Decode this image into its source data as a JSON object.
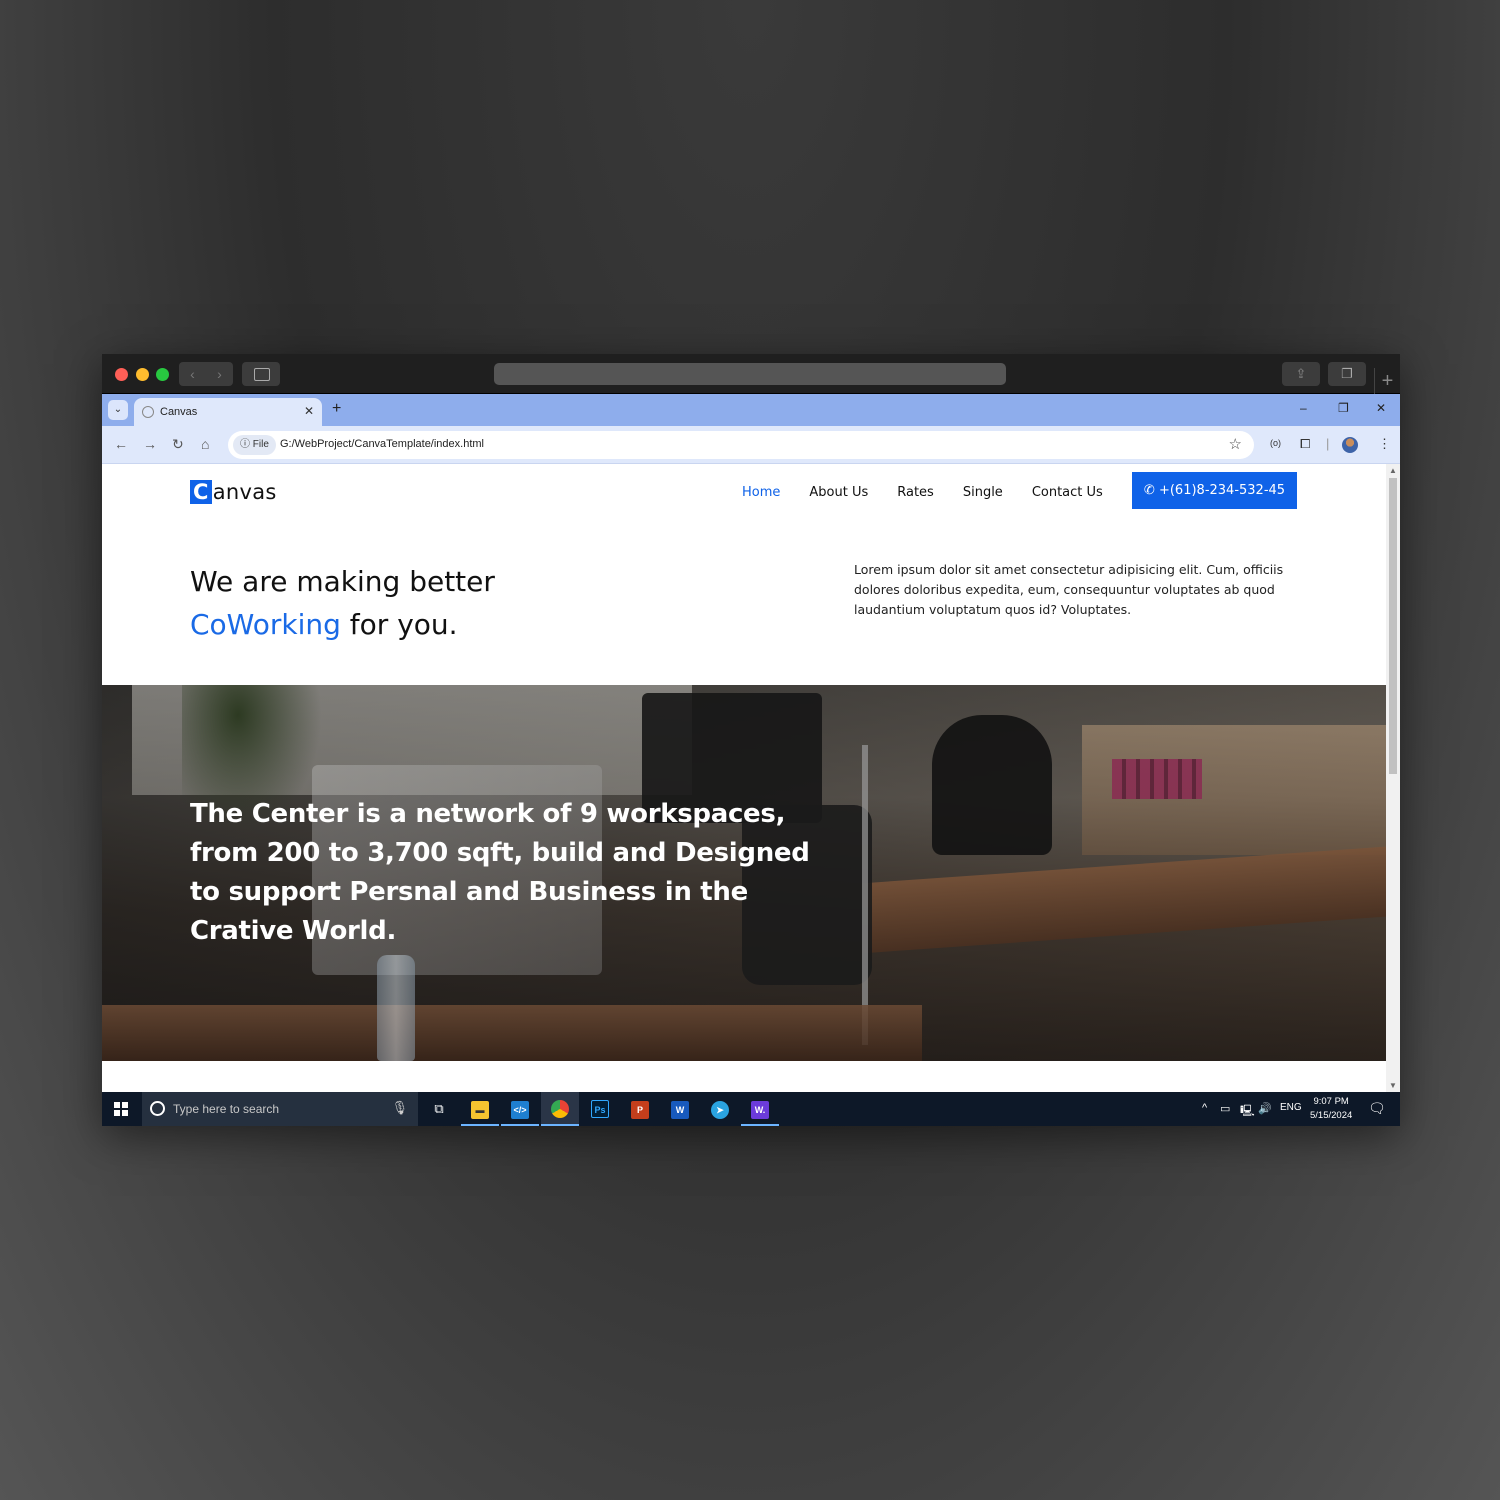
{
  "browser": {
    "tab_title": "Canvas",
    "url_chip": "File",
    "url": "G:/WebProject/CanvaTemplate/index.html",
    "window_controls": {
      "minimize": "–",
      "restore": "❐",
      "close": "✕"
    }
  },
  "site": {
    "logo_initial": "C",
    "logo_rest": "anvas",
    "nav": [
      {
        "label": "Home",
        "active": true
      },
      {
        "label": "About Us",
        "active": false
      },
      {
        "label": "Rates",
        "active": false
      },
      {
        "label": "Single",
        "active": false
      },
      {
        "label": "Contact Us",
        "active": false
      }
    ],
    "phone": "+(61)8-234-532-45",
    "hero": {
      "line1": "We are making better",
      "accent": "CoWorking",
      "line2_rest": " for you.",
      "description": "Lorem ipsum dolor sit amet consectetur adipisicing elit. Cum, officiis dolores doloribus expedita, eum, consequuntur voluptates ab quod laudantium voluptatum quos id? Voluptates."
    },
    "banner_text": "The Center is a network of 9 workspaces, from 200 to 3,700 sqft, build and Designed to support Persnal and Business in the Crative World.",
    "accent_color": "#0f62e8"
  },
  "taskbar": {
    "search_placeholder": "Type here to search",
    "tray_lang": "ENG",
    "time": "9:07 PM",
    "date": "5/15/2024",
    "apps": [
      {
        "name": "task-view-icon",
        "glyph": "⧉"
      },
      {
        "name": "file-explorer-icon",
        "glyph": "📁"
      },
      {
        "name": "vscode-icon",
        "glyph": "⟨⟩"
      },
      {
        "name": "chrome-icon",
        "glyph": "◉"
      },
      {
        "name": "photoshop-icon",
        "glyph": "Ps"
      },
      {
        "name": "powerpoint-icon",
        "glyph": "P"
      },
      {
        "name": "word-icon",
        "glyph": "W"
      },
      {
        "name": "telegram-icon",
        "glyph": "➤"
      },
      {
        "name": "webflow-icon",
        "glyph": "W."
      }
    ]
  }
}
